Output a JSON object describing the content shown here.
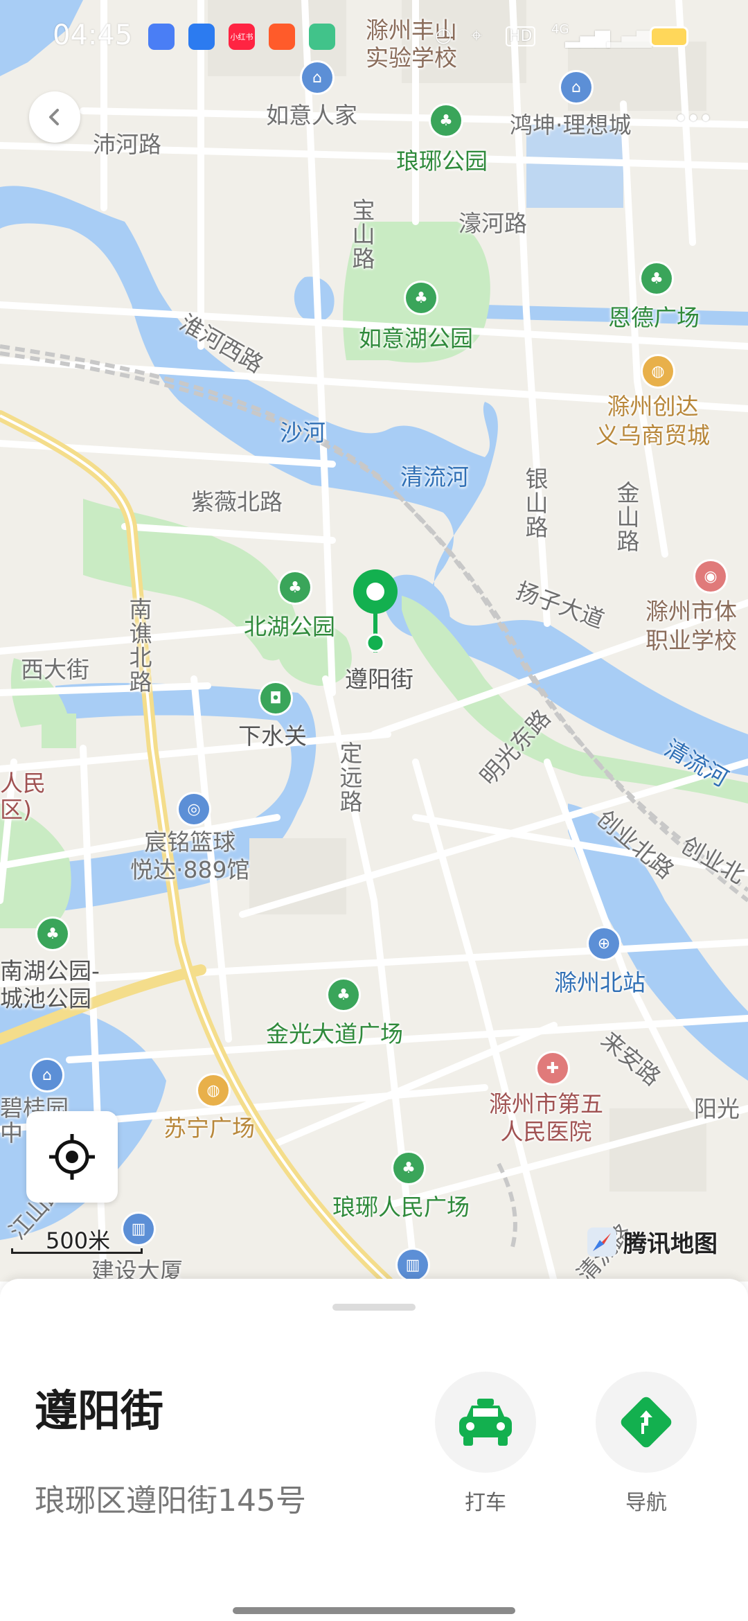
{
  "status_bar": {
    "time": "04:45",
    "network": "4G",
    "hd": "HD",
    "apps": [
      {
        "name": "app-icon-1",
        "color": "#4a7ef5"
      },
      {
        "name": "app-icon-2",
        "color": "#2c7bf0"
      },
      {
        "name": "xiaohongshu-icon",
        "color": "#ff2442",
        "label": "小红书"
      },
      {
        "name": "app-icon-4",
        "color": "#ff5b2a"
      },
      {
        "name": "app-icon-5",
        "color": "#41c38a"
      }
    ]
  },
  "map": {
    "labels": {
      "school": "滁州丰山\n实验学校",
      "ruyi_home": "如意人家",
      "hongkun": "鸿坤·理想城",
      "peihe_road": "沛河路",
      "langya_park": "琅琊公园",
      "haohe_road": "濠河路",
      "baoshan_road": "宝山路",
      "ende_square": "恩德广场",
      "ruyi_lake_park": "如意湖公园",
      "huaihe_west_road": "淮河西路",
      "chuzhou_chuangda": "滁州创达\n义乌商贸城",
      "sha_river": "沙河",
      "qingliu_river": "清流河",
      "ziwei_north_road": "紫薇北路",
      "yinshan_road": "银山路",
      "jinshan_road": "金山路",
      "yangzi_avenue": "扬子大道",
      "chuzhou_sports_school": "滁州市体\n职业学校",
      "nanqiao_north_road": "南谯北路",
      "beihu_park": "北湖公园",
      "xida_street": "西大街",
      "zunyang_street_map": "遵阳街",
      "xiashuiguan": "下水关",
      "dingyuan_road": "定远路",
      "mingguang_east_road": "明光东路",
      "qingliu_river_east": "清流河",
      "renmin_district": "人民\n区)",
      "chenming_basketball": "宸铭篮球\n悦达·889馆",
      "chuangye_north_road": "创业北路",
      "chuangye_road": "创业北",
      "nanhu_park": "南湖公园-\n城池公园",
      "chuzhou_north_station": "滁州北站",
      "jinguang_square": "金光大道广场",
      "laian_road": "来安路",
      "bigui_garden": "碧桂园\n中",
      "suning_plaza": "苏宁广场",
      "fifth_hospital": "滁州市第五\n人民医院",
      "yangguang": "阳光",
      "langya_renmin_square": "琅琊人民广场",
      "jiangshan_road": "江山路",
      "jianshe_building": "建设大厦",
      "qingliu_road": "清流路"
    },
    "scale_label": "500米",
    "brand": "腾讯地图",
    "colors": {
      "water": "#a8cdf5",
      "park": "#c9ebc3",
      "road": "#ffffff",
      "main_road": "#f7e7a6",
      "pin": "#13b04f"
    }
  },
  "sheet": {
    "place_name": "遵阳街",
    "address": "琅琊区遵阳街145号",
    "actions": [
      {
        "label": "打车",
        "icon": "taxi-icon"
      },
      {
        "label": "导航",
        "icon": "navigation-icon"
      }
    ]
  }
}
